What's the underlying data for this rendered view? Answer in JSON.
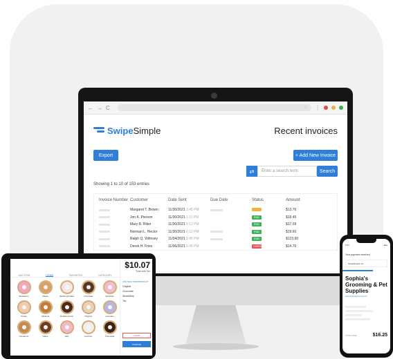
{
  "browser": {
    "nav_icons": [
      "←",
      "→",
      "C"
    ],
    "star_icon": "☆",
    "menu_icon": "⋮",
    "dots": [
      "#e34b3f",
      "#e7b43a",
      "#3aaf4f"
    ]
  },
  "app": {
    "brand_prefix": "Swipe",
    "brand_suffix": "Simple",
    "title": "Recent invoices",
    "export_label": "Export",
    "add_label": "+  Add New Invoice",
    "search_placeholder": "Enter a search term",
    "search_label": "Search",
    "showing": "Showing 1 to 10 of 153 entries",
    "columns": [
      "Invoice Number",
      "Customer",
      "Date Sent",
      "Due Date",
      "Status",
      "Amount"
    ],
    "rows": [
      {
        "customer": "Margaret T. Brown",
        "date": "11/30/2021",
        "time": "2:45 PM",
        "due": "",
        "status": "",
        "status_color": "#f1b43a",
        "amount": "$13.76"
      },
      {
        "customer": "Jon K. Pierson",
        "date": "11/30/2021",
        "time": "1:11 PM",
        "due": "",
        "status": "PAID",
        "status_color": "#3cb05a",
        "amount": "$19.45"
      },
      {
        "customer": "Mary R. Riker",
        "date": "11/30/2021",
        "time": "8:12 PM",
        "due": "",
        "status": "PAID",
        "status_color": "#3cb05a",
        "amount": "$17.09"
      },
      {
        "customer": "Norman L. Hector",
        "date": "11/30/2021",
        "time": "6:12 PM",
        "due": "",
        "status": "PAID",
        "status_color": "#3cb05a",
        "amount": "$19.60"
      },
      {
        "customer": "Ralph Q. Wilmsey",
        "date": "11/04/2021",
        "time": "2:45 PM",
        "due": "",
        "status": "PAID",
        "status_color": "#3cb05a",
        "amount": "$123.99"
      },
      {
        "customer": "Derek H. Fries",
        "date": "11/06/2021",
        "time": "6:45 PM",
        "due": "",
        "status": "OVERDUE",
        "status_color": "#e05555",
        "amount": "$14.70"
      }
    ]
  },
  "tablet": {
    "total": "$10.07",
    "total_label": "Total with Tax",
    "tabs": [
      "ADD ITEM",
      "ITEMS",
      "FAVORITES",
      "CATEGORY"
    ],
    "items_header": "ADD NEW ITEM/PRODUCT",
    "cart": [
      "Original",
      "Chocolate",
      "Strawberry",
      "Tax"
    ],
    "clear": "CLEAR",
    "charge": "CHARGE",
    "donuts": [
      {
        "name": "Strawberry",
        "color": "#f4a6c4"
      },
      {
        "name": "Maple",
        "color": "#d9a066"
      },
      {
        "name": "Vanilla sprinkles",
        "color": "#f7e4e9"
      },
      {
        "name": "Chocolate",
        "color": "#5a3624"
      },
      {
        "name": "Sprinkles",
        "color": "#f1bcd3"
      },
      {
        "name": "Frosty",
        "color": "#f3c9b2"
      },
      {
        "name": "Caramel",
        "color": "#c57b3c"
      },
      {
        "name": "Double Choco",
        "color": "#4a2b1c"
      },
      {
        "name": "Original",
        "color": "#e8d3b9"
      },
      {
        "name": "Lavender",
        "color": "#b8b6e6"
      },
      {
        "name": "Cinnamon",
        "color": "#c48a52"
      },
      {
        "name": "Glaze",
        "color": "#6b3f26"
      },
      {
        "name": "Jelly",
        "color": "#f0b9cd"
      },
      {
        "name": "Coconut",
        "color": "#f2eee9"
      },
      {
        "name": "Chocolate",
        "color": "#3a2418"
      }
    ]
  },
  "phone": {
    "status_left": "9:41",
    "status_right": "●●●",
    "notice": "Your payment received",
    "card": "SwipeSimple Inc.",
    "business": "Sophia's Grooming & Pet Supplies",
    "link": "www.sophiasgrooming.com",
    "total_label": "TOTAL DUE",
    "total": "$16.25"
  }
}
